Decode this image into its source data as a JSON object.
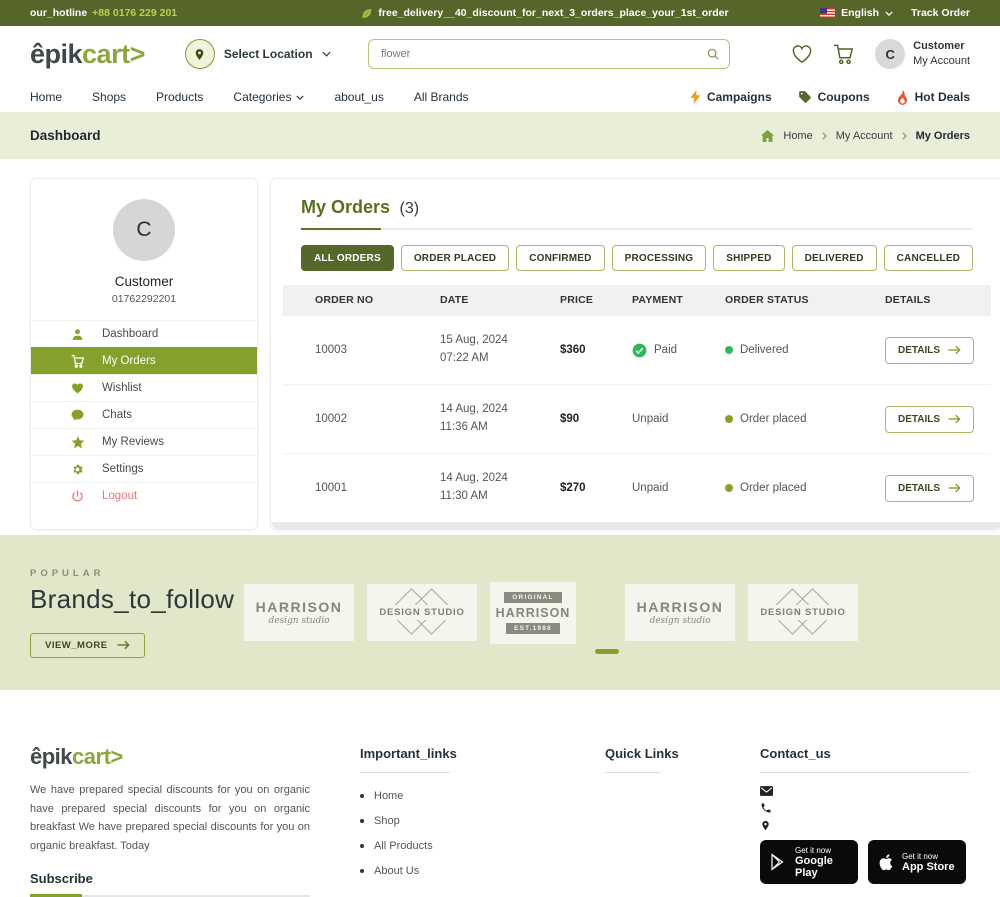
{
  "topbar": {
    "hotline_label": "our_hotline",
    "hotline_number": "+88 0176 229 201",
    "promo": "free_delivery__40_discount_for_next_3_orders_place_your_1st_order",
    "language": "English",
    "track_order": "Track Order"
  },
  "header": {
    "logo_part1": "êpik",
    "logo_part2": "cart",
    "logo_arrow": ">",
    "select_location": "Select Location",
    "search_value": "flower",
    "avatar_letter": "C",
    "account_name": "Customer",
    "account_sub": "My Account"
  },
  "nav": {
    "links": [
      "Home",
      "Shops",
      "Products",
      "Categories",
      "about_us",
      "All Brands"
    ],
    "highlights": [
      "Campaigns",
      "Coupons",
      "Hot Deals"
    ]
  },
  "breadcrumb": {
    "page_title": "Dashboard",
    "items": [
      "Home",
      "My Account",
      "My Orders"
    ]
  },
  "sidebar": {
    "avatar_letter": "C",
    "name": "Customer",
    "phone": "01762292201",
    "items": [
      {
        "label": "Dashboard"
      },
      {
        "label": "My Orders"
      },
      {
        "label": "Wishlist"
      },
      {
        "label": "Chats"
      },
      {
        "label": "My Reviews"
      },
      {
        "label": "Settings"
      },
      {
        "label": "Logout"
      }
    ]
  },
  "orders": {
    "title": "My Orders",
    "count": "(3)",
    "filters": [
      "ALL ORDERS",
      "ORDER PLACED",
      "CONFIRMED",
      "PROCESSING",
      "SHIPPED",
      "DELIVERED",
      "CANCELLED"
    ],
    "columns": [
      "ORDER NO",
      "DATE",
      "PRICE",
      "PAYMENT",
      "ORDER STATUS",
      "DETAILS"
    ],
    "details_label": "DETAILS",
    "rows": [
      {
        "order_no": "10003",
        "date_line1": "15 Aug, 2024",
        "date_line2": "07:22 AM",
        "price": "$360",
        "payment": "Paid",
        "status": "Delivered",
        "status_color": "#2eb85c"
      },
      {
        "order_no": "10002",
        "date_line1": "14 Aug, 2024",
        "date_line2": "11:36 AM",
        "price": "$90",
        "payment": "Unpaid",
        "status": "Order placed",
        "status_color": "#84a22b"
      },
      {
        "order_no": "10001",
        "date_line1": "14 Aug, 2024",
        "date_line2": "11:30 AM",
        "price": "$270",
        "payment": "Unpaid",
        "status": "Order placed",
        "status_color": "#84a22b"
      }
    ]
  },
  "brands": {
    "eyebrow": "POPULAR",
    "title": "Brands_to_follow",
    "view_more": "VIEW_MORE",
    "cards": [
      {
        "line1": "HARRISON",
        "line2": "design studio"
      },
      {
        "line1": "DESIGN STUDIO"
      },
      {
        "top": "ORIGINAL",
        "line1": "HARRISON",
        "bottom": "EST.1986"
      },
      {
        "line1": "HARRISON",
        "line2": "design studio"
      },
      {
        "line1": "DESIGN STUDIO"
      }
    ]
  },
  "footer": {
    "about": "We have prepared special discounts for you on organic have prepared special discounts for you on organic breakfast We have prepared special discounts for you on organic breakfast. Today",
    "subscribe": "Subscribe",
    "col2_title": "Important_links",
    "col2_links": [
      "Home",
      "Shop",
      "All Products",
      "About Us"
    ],
    "col3_title": "Quick Links",
    "col4_title": "Contact_us",
    "apps": [
      {
        "line1": "Get it now",
        "line2": "Google Play"
      },
      {
        "line1": "Get it now",
        "line2": "App Store"
      }
    ]
  },
  "colors": {
    "topbar_bg": "#566529",
    "accent_olive": "#84a22b",
    "dark_olive": "#55682b",
    "hotline_number": "#bdd04f",
    "breadcrumb_bg": "#e9eed8",
    "brands_bg": "#e2e7c9",
    "paid_green": "#2eb85c",
    "logout_red": "#f07272"
  }
}
